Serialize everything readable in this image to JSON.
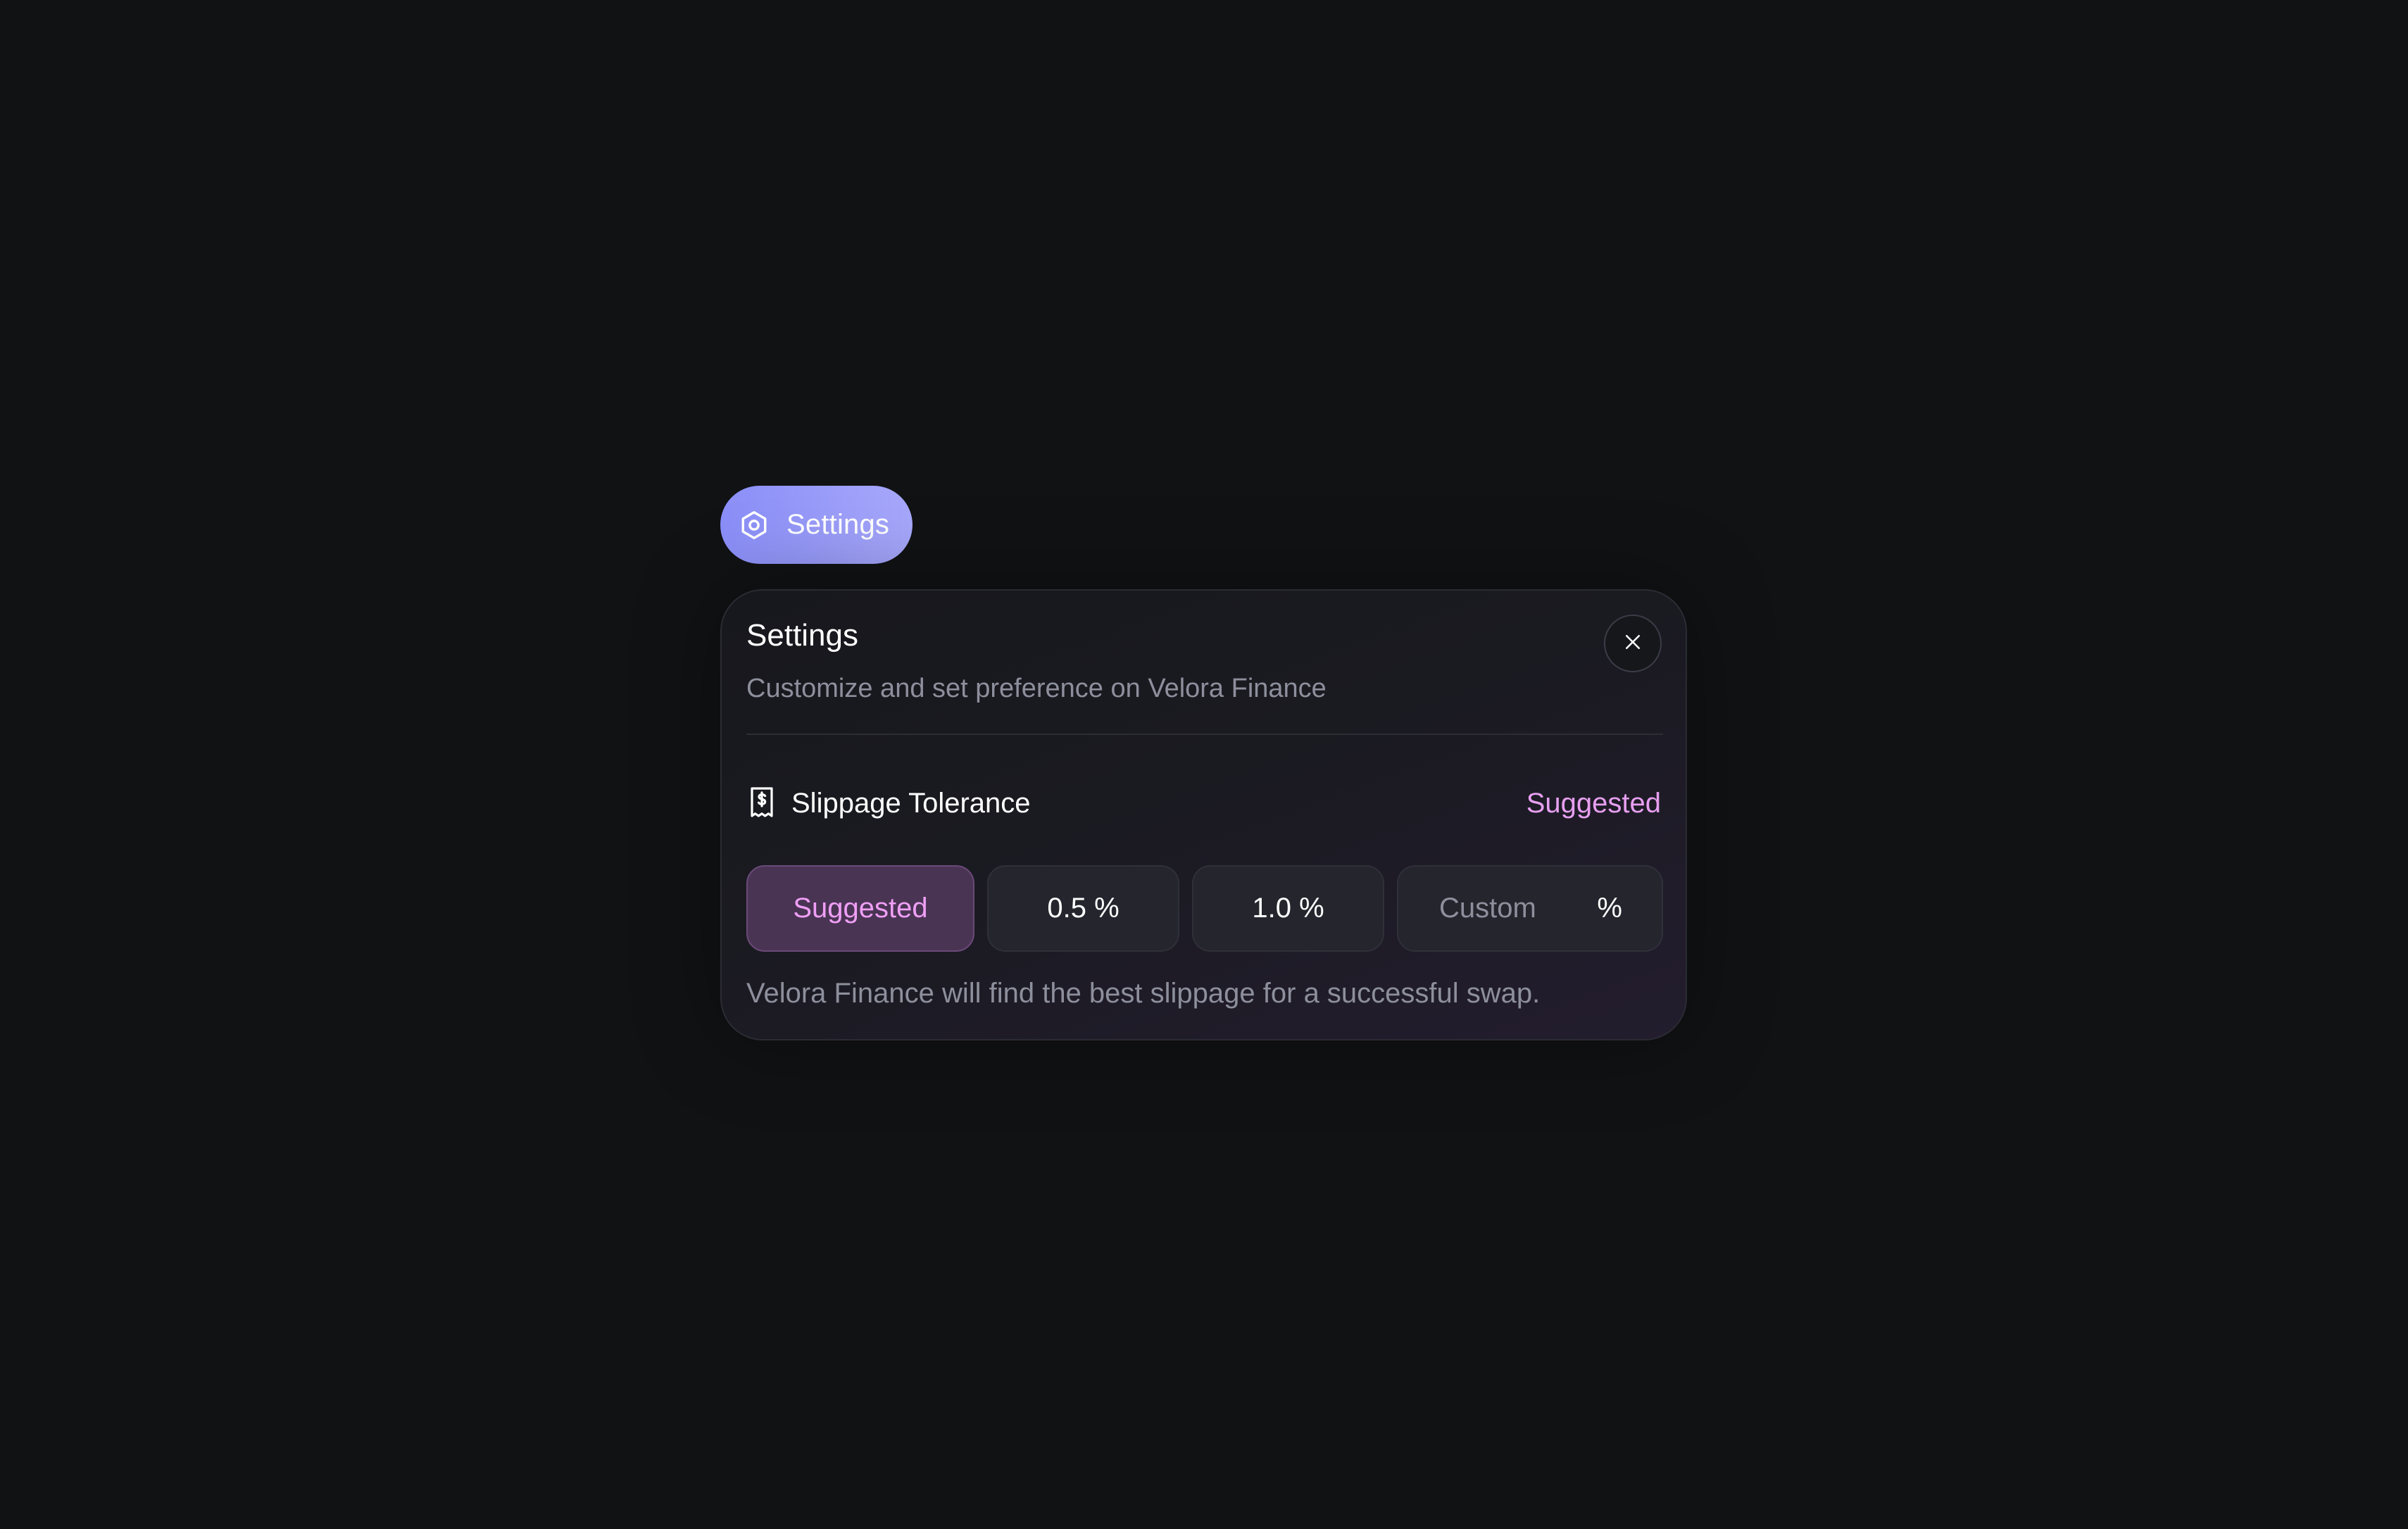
{
  "trigger": {
    "label": "Settings",
    "icon": "settings-gear-icon"
  },
  "panel": {
    "title": "Settings",
    "subtitle": "Customize and set preference on Velora Finance",
    "close_icon": "close-icon",
    "slippage": {
      "label": "Slippage Tolerance",
      "icon": "receipt-dollar-icon",
      "current_value": "Suggested",
      "options": [
        {
          "label": "Suggested",
          "selected": true
        },
        {
          "label": "0.5 %",
          "selected": false
        },
        {
          "label": "1.0 %",
          "selected": false
        }
      ],
      "custom": {
        "placeholder": "Custom",
        "value": "",
        "unit": "%"
      },
      "helper": "Velora Finance will find the best slippage for a successful swap."
    }
  },
  "colors": {
    "background": "#111214",
    "accent_pill": "#9a9cf9",
    "accent_pink": "#e79ff0",
    "muted_text": "#8d8f9c"
  }
}
